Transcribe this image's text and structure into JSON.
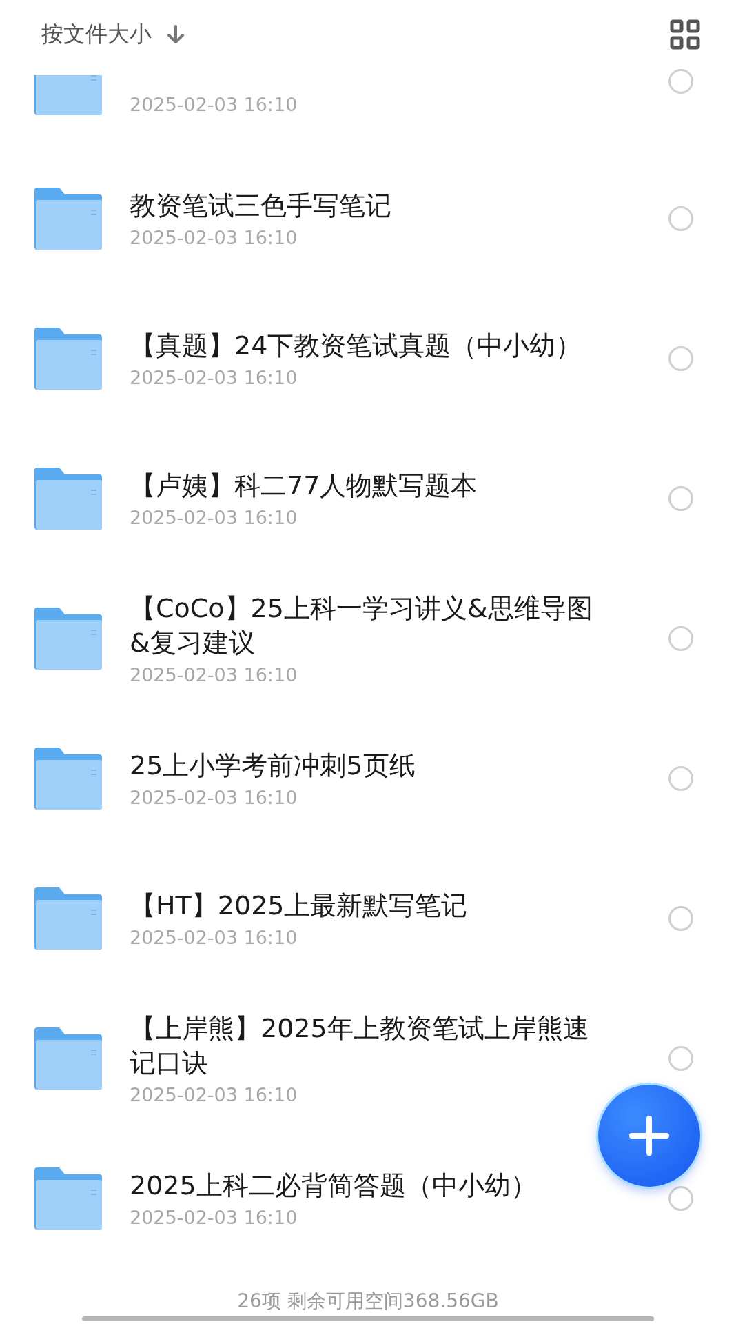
{
  "header": {
    "sort_label": "按文件大小"
  },
  "items": [
    {
      "kind": "partial",
      "date": "2025-02-03 16:10",
      "selected": false
    },
    {
      "kind": "folder",
      "name": "教资笔试三色手写笔记",
      "date": "2025-02-03 16:10",
      "selected": false
    },
    {
      "kind": "folder",
      "name": "【真题】24下教资笔试真题（中小幼）",
      "date": "2025-02-03 16:10",
      "selected": false
    },
    {
      "kind": "folder",
      "name": "【卢姨】科二77人物默写题本",
      "date": "2025-02-03 16:10",
      "selected": false
    },
    {
      "kind": "folder",
      "name": "【CoCo】25上科一学习讲义&思维导图&复习建议",
      "date": "2025-02-03 16:10",
      "selected": false
    },
    {
      "kind": "folder",
      "name": "25上小学考前冲刺5页纸",
      "date": "2025-02-03 16:10",
      "selected": false
    },
    {
      "kind": "folder",
      "name": "【HT】2025上最新默写笔记",
      "date": "2025-02-03 16:10",
      "selected": false
    },
    {
      "kind": "folder",
      "name": "【上岸熊】2025年上教资笔试上岸熊速记口诀",
      "date": "2025-02-03 16:10",
      "selected": false
    },
    {
      "kind": "folder",
      "name": "2025上科二必背简答题（中小幼）",
      "date": "2025-02-03 16:10",
      "selected": false
    }
  ],
  "footer": {
    "summary": "26项 剩余可用空间368.56GB"
  }
}
